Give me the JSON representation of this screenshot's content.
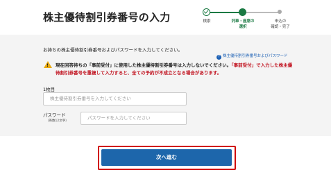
{
  "header": {
    "title": "株主優待割引券番号の入力"
  },
  "stepper": {
    "steps": [
      {
        "label": "検索",
        "state": "complete"
      },
      {
        "label": "列車・座席の\n選択",
        "state": "current"
      },
      {
        "label": "申込の\n確認・完了",
        "state": "upcoming"
      }
    ]
  },
  "form": {
    "instruction": "お持ちの株主優待割引券番号およびパスワードを入力してください。",
    "help_link": "株主優待割引券番号およびパスワード",
    "warning": {
      "part1": "現在回答待ちの「事前受付」に使用した株主優待割引券番号は入力しないでください。",
      "part2": "「事前受付」で入力した株主優待割引券番号を重複して入力すると、全ての予約が不成立となる場合があります。"
    },
    "coupon_label": "1枚目",
    "coupon_placeholder": "株主優待割引券番号を入力してください",
    "password_label": "パスワード",
    "password_sublabel": "（英数12文字）",
    "password_placeholder": "パスワードを入力してください"
  },
  "actions": {
    "next_label": "次へ進む"
  },
  "colors": {
    "accent_green": "#1b7a43",
    "link_blue": "#1a5fb4",
    "primary_button": "#1d66ab",
    "warning_red": "#c1121f",
    "highlight_border": "#d00000",
    "warning_icon": "#e8a90f"
  }
}
